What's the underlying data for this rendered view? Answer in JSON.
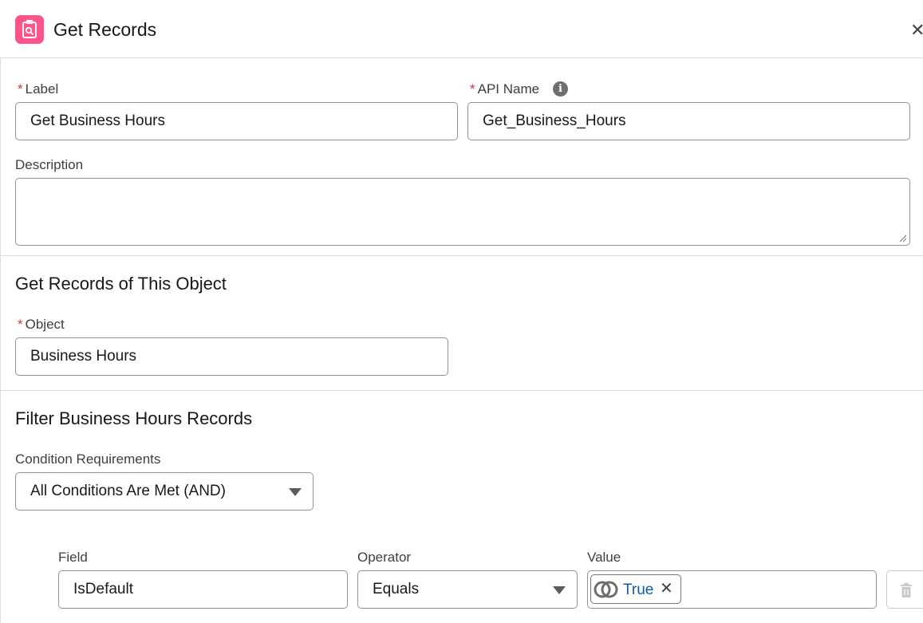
{
  "header": {
    "title": "Get Records",
    "icon": "get-records-icon",
    "icon_color": "#ff538a",
    "close_icon": "close-icon"
  },
  "label_field": {
    "label": "Label",
    "required_marker": "*",
    "value": "Get Business Hours"
  },
  "api_name_field": {
    "label": "API Name",
    "required_marker": "*",
    "value": "Get_Business_Hours",
    "info_glyph": "i"
  },
  "description_field": {
    "label": "Description",
    "value": ""
  },
  "object_section": {
    "title": "Get Records of This Object",
    "object_label": "Object",
    "required_marker": "*",
    "object_value": "Business Hours"
  },
  "filter_section": {
    "title": "Filter Business Hours Records",
    "condition_label": "Condition Requirements",
    "condition_value": "All Conditions Are Met (AND)"
  },
  "condition_row": {
    "field_header": "Field",
    "operator_header": "Operator",
    "value_header": "Value",
    "field_value": "IsDefault",
    "operator_value": "Equals",
    "value_pill": "True",
    "pill_icon": "boolean-icon",
    "pill_remove_icon": "close-icon",
    "delete_icon": "trash-icon"
  },
  "colors": {
    "required": "#c23934",
    "pill_text": "#0b5cab",
    "border": "#939393"
  }
}
